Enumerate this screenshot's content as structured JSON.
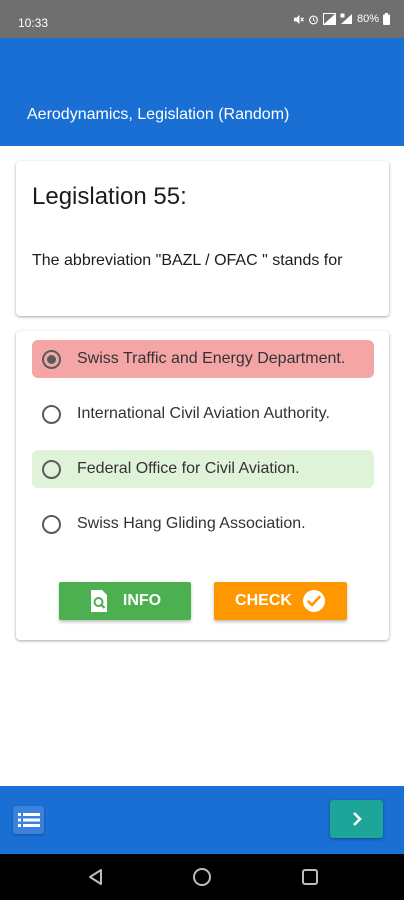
{
  "status_bar": {
    "time": "10:33",
    "battery": "80%"
  },
  "header": {
    "title": "Aerodynamics, Legislation (Random)"
  },
  "question": {
    "title": "Legislation 55:",
    "text": "The abbreviation \"BAZL / OFAC \" stands for"
  },
  "answers": [
    {
      "label": "Swiss Traffic and Energy Department.",
      "state": "selected-wrong"
    },
    {
      "label": "International Civil Aviation Authority.",
      "state": "none"
    },
    {
      "label": "Federal Office for Civil Aviation.",
      "state": "correct"
    },
    {
      "label": "Swiss Hang Gliding Association.",
      "state": "none"
    }
  ],
  "buttons": {
    "info_label": "INFO",
    "check_label": "CHECK"
  },
  "colors": {
    "primary": "#1a6fd4",
    "wrong": "#f4a6a6",
    "correct": "#dff3d9",
    "info": "#4caf50",
    "check": "#ff9800",
    "next": "#1da59a"
  },
  "icons": {
    "info_button": "search-document-icon",
    "check_button": "check-circle-icon",
    "bottom_left": "list-icon",
    "bottom_right": "chevron-right-icon"
  }
}
